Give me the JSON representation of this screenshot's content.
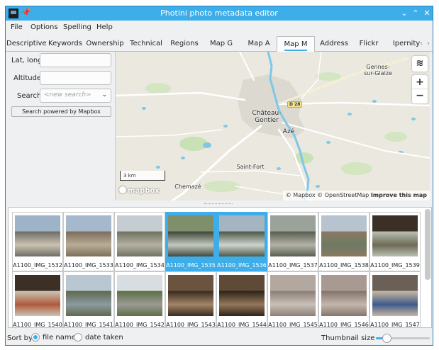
{
  "window": {
    "title": "Photini photo metadata editor"
  },
  "menu": [
    "File",
    "Options",
    "Spelling",
    "Help"
  ],
  "tabs": [
    "Descriptive",
    "Keywords",
    "Ownership",
    "Technical",
    "Regions",
    "Map G",
    "Map A",
    "Map M",
    "Address",
    "Flickr",
    "Ipernity"
  ],
  "active_tab": "Map M",
  "form": {
    "latlong_label": "Lat, long",
    "latlong_value": "",
    "altitude_label": "Altitude",
    "altitude_value": "",
    "search_label": "Search",
    "search_placeholder": "<new search>",
    "search_button": "Search powered by Mapbox"
  },
  "map": {
    "labels": {
      "gennes": "Gennes-\nsur-Glaize",
      "chateau": "Château-\nGontier",
      "aze": "Azé",
      "saintfort": "Saint-Fort",
      "chemaze": "Chemazé",
      "road": "D 28"
    },
    "scale": "3 km",
    "logo": "mapbox",
    "attribution_mapbox": "© Mapbox",
    "attribution_osm": "© OpenStreetMap",
    "attribution_improve": "Improve this map",
    "zoom_in": "+",
    "zoom_out": "−"
  },
  "thumbnails": [
    {
      "caption": "A1100_IMG_1532",
      "selected": false,
      "palette": [
        "#9fb3c8",
        "#6f6d66",
        "#c9c2b0"
      ]
    },
    {
      "caption": "A1100_IMG_1533",
      "selected": false,
      "palette": [
        "#a6b8cb",
        "#7c6e5c",
        "#b9ad96"
      ]
    },
    {
      "caption": "A1100_IMG_1534",
      "selected": false,
      "palette": [
        "#c6cdd2",
        "#6f7460",
        "#b5b0a2"
      ]
    },
    {
      "caption": "A1100_IMG_1535",
      "selected": true,
      "palette": [
        "#7f8f6c",
        "#3f4a3a",
        "#c3c7c0"
      ]
    },
    {
      "caption": "A1100_IMG_1536",
      "selected": true,
      "palette": [
        "#a4b4c0",
        "#4e5a48",
        "#cfd3cf"
      ]
    },
    {
      "caption": "A1100_IMG_1537",
      "selected": false,
      "palette": [
        "#9aa29a",
        "#596050",
        "#b3b1a8"
      ]
    },
    {
      "caption": "A1100_IMG_1538",
      "selected": false,
      "palette": [
        "#b7c4cf",
        "#8a7960",
        "#6d7a63"
      ]
    },
    {
      "caption": "A1100_IMG_1539",
      "selected": false,
      "palette": [
        "#3a3026",
        "#b8c0b2",
        "#6e6a55"
      ]
    },
    {
      "caption": "A1100_IMG_1540",
      "selected": false,
      "palette": [
        "#3c2f25",
        "#c9c4b4",
        "#b05a3c"
      ]
    },
    {
      "caption": "A1100_IMG_1541",
      "selected": false,
      "palette": [
        "#b8c7d2",
        "#5f6a4e",
        "#8c9aa0"
      ]
    },
    {
      "caption": "A1100_IMG_1542",
      "selected": false,
      "palette": [
        "#d7dde0",
        "#5f7046",
        "#9a9a94"
      ]
    },
    {
      "caption": "A1100_IMG_1543",
      "selected": false,
      "palette": [
        "#6a5440",
        "#3a2c20",
        "#a28568"
      ]
    },
    {
      "caption": "A1100_IMG_1544",
      "selected": false,
      "palette": [
        "#5e4a36",
        "#2f2419",
        "#93785c"
      ]
    },
    {
      "caption": "A1100_IMG_1545",
      "selected": false,
      "palette": [
        "#b2a8a0",
        "#8d8078",
        "#c9c0b8"
      ]
    },
    {
      "caption": "A1100_IMG_1546",
      "selected": false,
      "palette": [
        "#a89a92",
        "#85766c",
        "#c4b6ac"
      ]
    },
    {
      "caption": "A1100_IMG_1547",
      "selected": false,
      "palette": [
        "#6a6058",
        "#c7b6a0",
        "#3e5b8c"
      ]
    }
  ],
  "bottom": {
    "sort_label": "Sort by",
    "opt_filename": "file name",
    "opt_date": "date taken",
    "thumb_size_label": "Thumbnail size",
    "thumb_size_fraction": 0.2
  },
  "colors": {
    "accent": "#3daee9",
    "water": "#7fc7e8",
    "park": "#c9e2b5"
  }
}
